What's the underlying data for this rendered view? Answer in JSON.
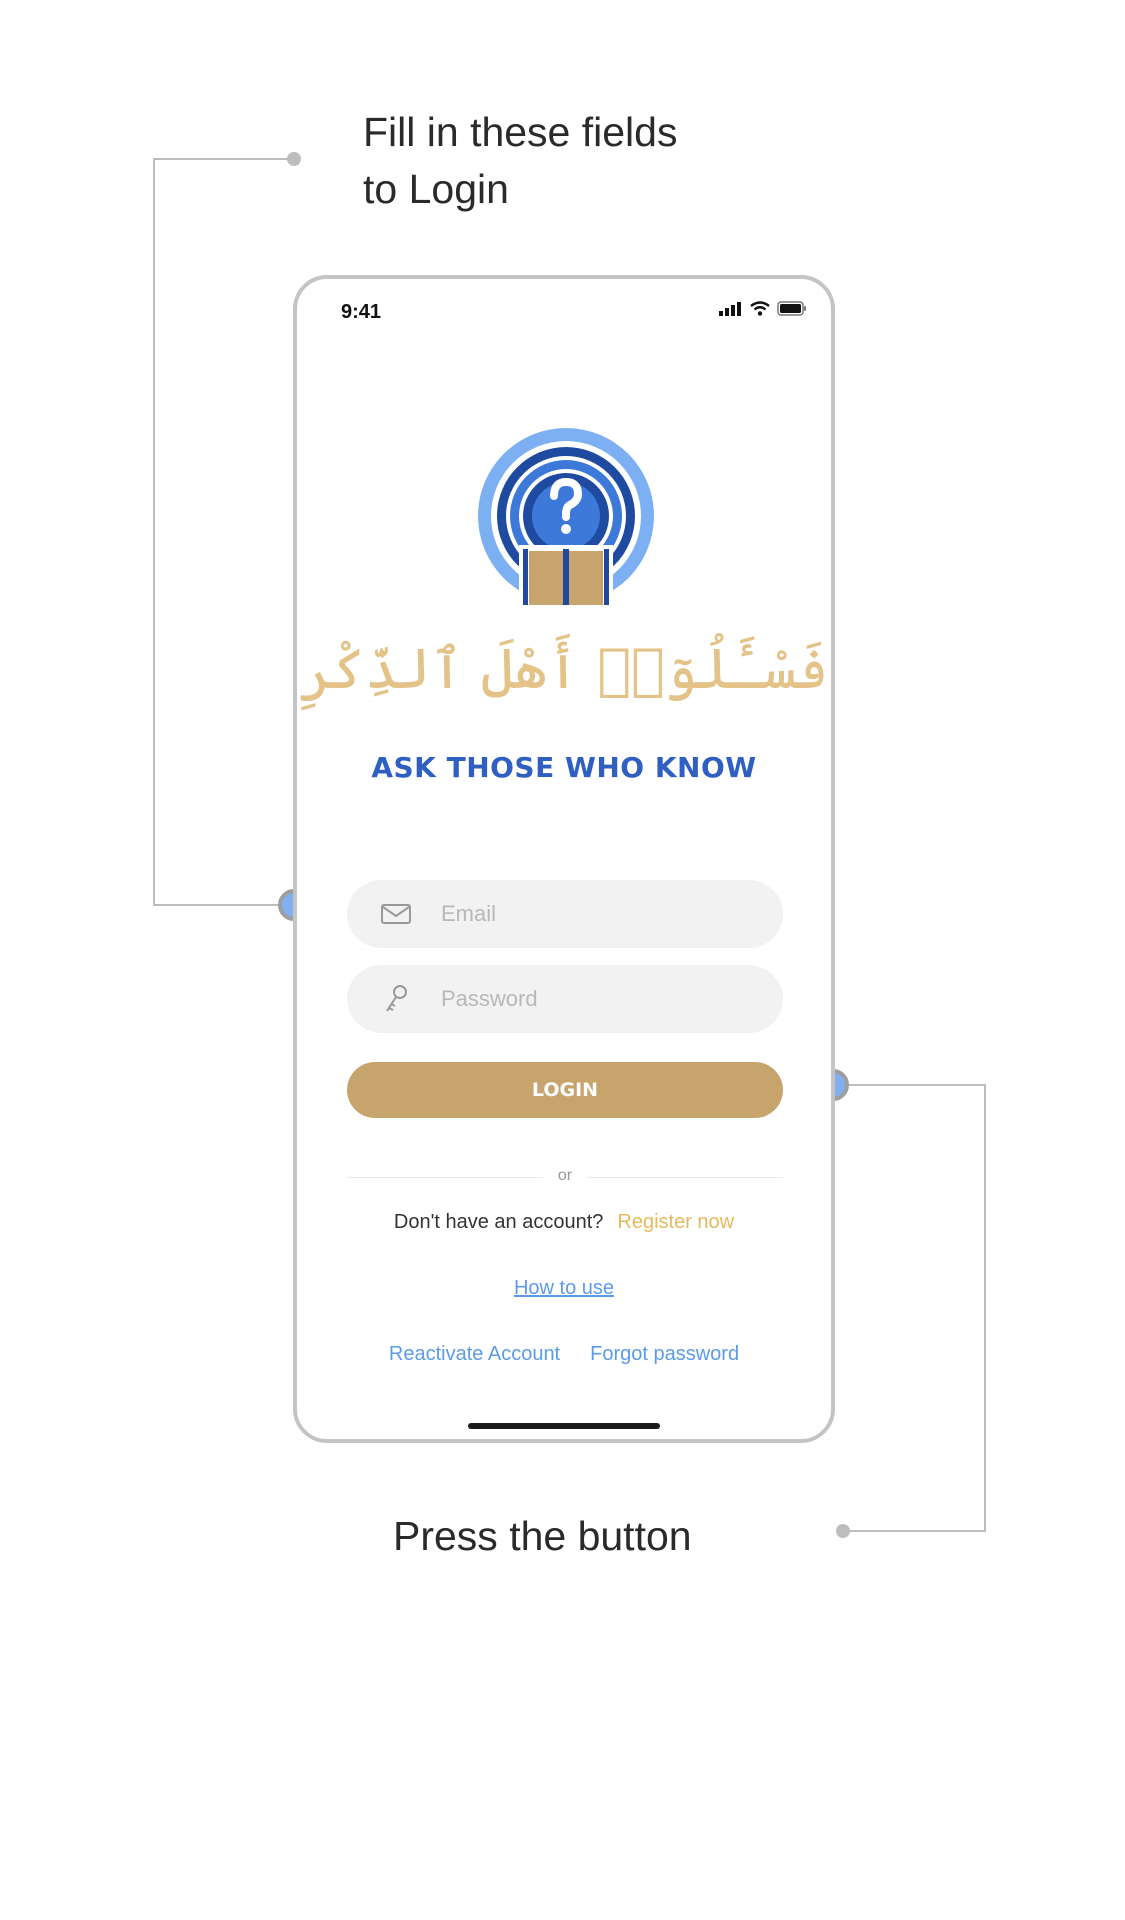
{
  "annotations": {
    "fields_note": "Fill in these fields\nto Login",
    "button_note": "Press the button"
  },
  "status_bar": {
    "time": "9:41"
  },
  "brand": {
    "arabic_text": "فَسْـَٔلُوٓا۟ أَهْلَ ٱلذِّكْرِ",
    "name": "ASK THOSE WHO KNOW"
  },
  "form": {
    "email_placeholder": "Email",
    "password_placeholder": "Password",
    "login_label": "LOGIN"
  },
  "divider_label": "or",
  "register": {
    "question": "Don't have an account?",
    "link": "Register now"
  },
  "how_to_use": "How to use",
  "links": {
    "reactivate": "Reactivate Account",
    "forgot": "Forgot password"
  },
  "colors": {
    "brand_blue": "#2f5fc0",
    "gold": "#c8a46d",
    "link_blue": "#5b9be9",
    "register_gold": "#e8b95c"
  },
  "icons": [
    "envelope-icon",
    "key-icon",
    "signal-icon",
    "wifi-icon",
    "battery-icon",
    "question-mark-icon",
    "open-book-icon"
  ]
}
